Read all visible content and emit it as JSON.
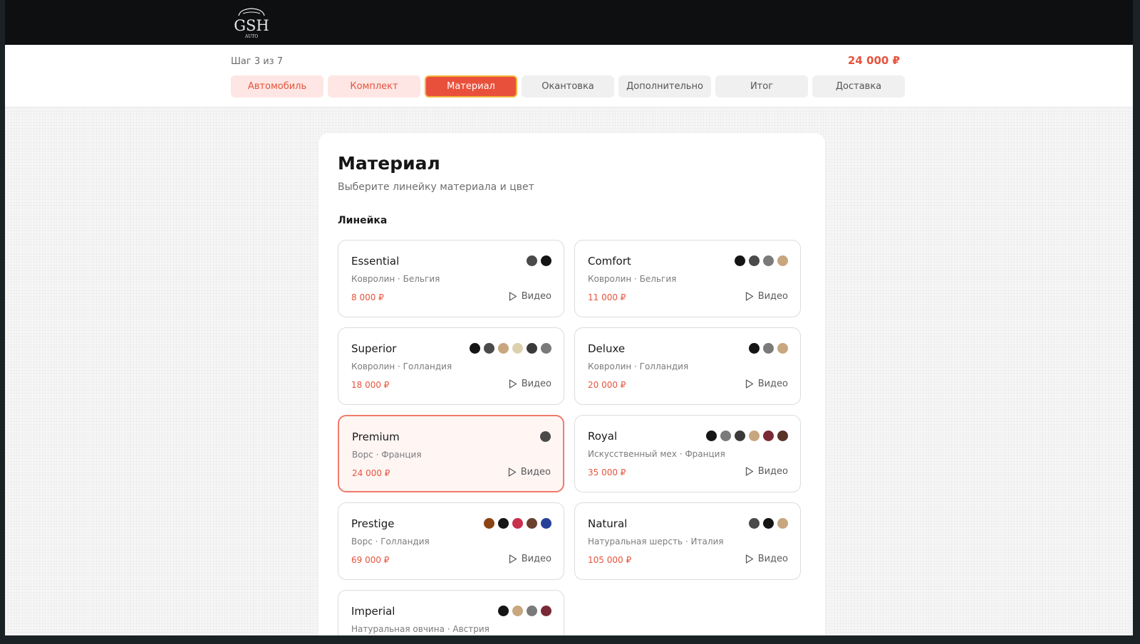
{
  "header": {
    "logo_text": "GSH",
    "logo_sub": "AUTO"
  },
  "stepper": {
    "step_label": "Шаг 3 из 7",
    "total": "24 000 ₽",
    "tabs": [
      {
        "label": "Автомобиль",
        "state": "done"
      },
      {
        "label": "Комплект",
        "state": "done"
      },
      {
        "label": "Материал",
        "state": "active"
      },
      {
        "label": "Окантовка",
        "state": "todo"
      },
      {
        "label": "Дополнительно",
        "state": "todo"
      },
      {
        "label": "Итог",
        "state": "todo"
      },
      {
        "label": "Доставка",
        "state": "todo"
      }
    ]
  },
  "main": {
    "title": "Материал",
    "subtitle": "Выберите линейку материала и цвет",
    "section_label": "Линейка",
    "video_label": "Видео",
    "lines": [
      {
        "name": "Essential",
        "origin": "Ковролин · Бельгия",
        "price": "8 000 ₽",
        "colors": [
          "#4a4a4a",
          "#151515"
        ],
        "selected": false
      },
      {
        "name": "Comfort",
        "origin": "Ковролин · Бельгия",
        "price": "11 000 ₽",
        "colors": [
          "#151515",
          "#4a4a4a",
          "#7a7a7a",
          "#c8a67e"
        ],
        "selected": false
      },
      {
        "name": "Superior",
        "origin": "Ковролин · Голландия",
        "price": "18 000 ₽",
        "colors": [
          "#151515",
          "#4a4a4a",
          "#c8a67e",
          "#ddd0ae",
          "#3a3a3a",
          "#7a7a7a"
        ],
        "selected": false
      },
      {
        "name": "Deluxe",
        "origin": "Ковролин · Голландия",
        "price": "20 000 ₽",
        "colors": [
          "#151515",
          "#7a7a7a",
          "#c8a67e"
        ],
        "selected": false
      },
      {
        "name": "Premium",
        "origin": "Ворс · Франция",
        "price": "24 000 ₽",
        "colors": [
          "#4a4a4a"
        ],
        "selected": true
      },
      {
        "name": "Royal",
        "origin": "Искусственный мех · Франция",
        "price": "35 000 ₽",
        "colors": [
          "#151515",
          "#7a7a7a",
          "#3a3a3a",
          "#c8a67e",
          "#7a2a36",
          "#5a3426"
        ],
        "selected": false
      },
      {
        "name": "Prestige",
        "origin": "Ворс · Голландия",
        "price": "69 000 ₽",
        "colors": [
          "#8a4414",
          "#151515",
          "#c8304e",
          "#6a4030",
          "#26409a"
        ],
        "selected": false
      },
      {
        "name": "Natural",
        "origin": "Натуральная шерсть · Италия",
        "price": "105 000 ₽",
        "colors": [
          "#4a4a4a",
          "#151515",
          "#c8a67e"
        ],
        "selected": false
      },
      {
        "name": "Imperial",
        "origin": "Натуральная овчина · Австрия",
        "price": "",
        "colors": [
          "#151515",
          "#c8a67e",
          "#7a7a7a",
          "#7a2a36"
        ],
        "selected": false
      }
    ]
  }
}
